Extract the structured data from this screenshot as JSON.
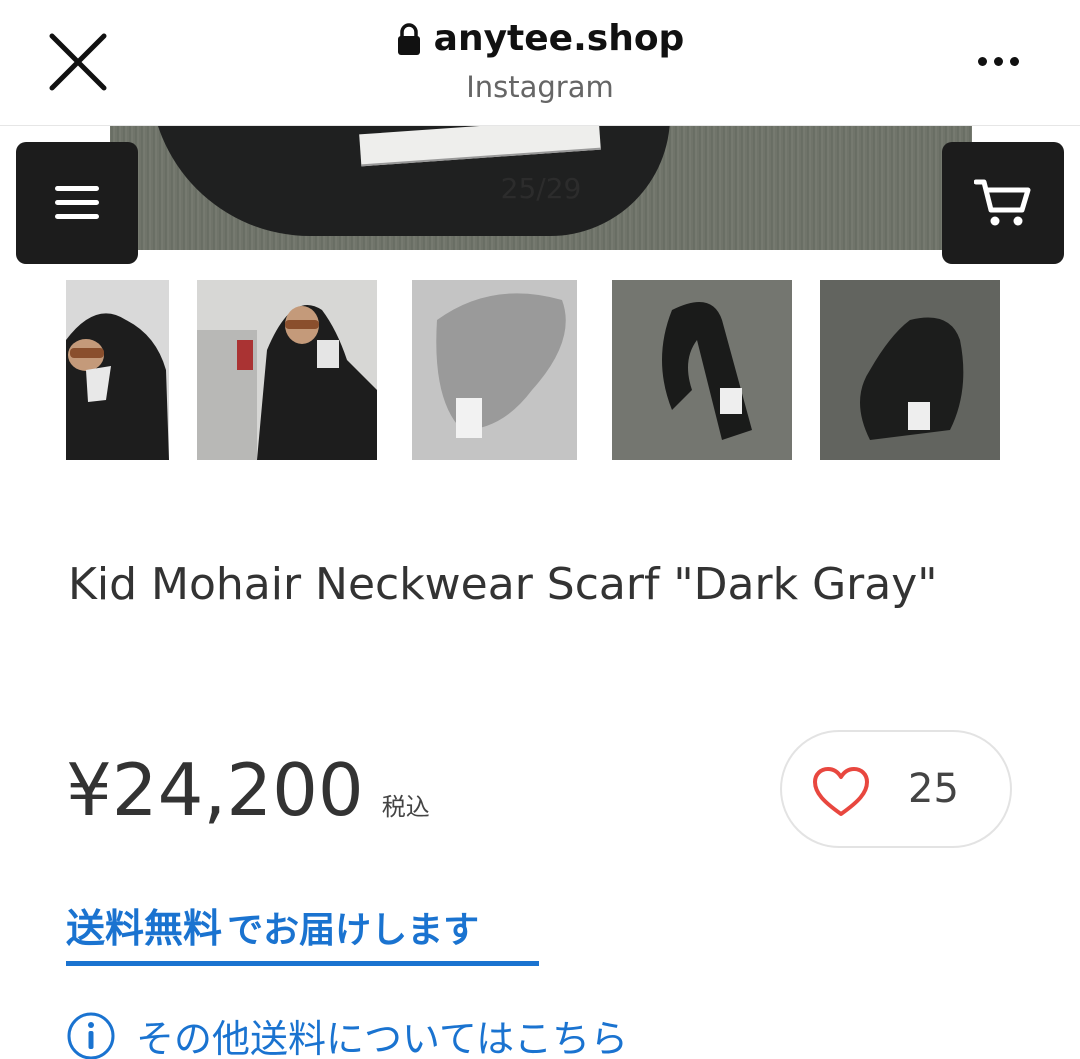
{
  "browser": {
    "domain": "anytee.shop",
    "subtitle": "Instagram"
  },
  "gallery": {
    "counter": "25/29",
    "thumbnails": [
      "thumbnail-1",
      "thumbnail-2",
      "thumbnail-3",
      "thumbnail-4",
      "thumbnail-5"
    ]
  },
  "product": {
    "title": "Kid Mohair Neckwear Scarf \"Dark Gray\"",
    "price": "¥24,200",
    "tax_label": "税込",
    "like_count": "25"
  },
  "shipping": {
    "free_label": "送料無料",
    "free_suffix": "でお届けします",
    "other_link": "その他送料についてはこちら"
  },
  "colors": {
    "accent": "#1a73d0",
    "heart": "#e8473f",
    "dark_button": "#1c1c1c"
  },
  "icons": [
    "close-icon",
    "lock-icon",
    "more-icon",
    "menu-icon",
    "cart-icon",
    "heart-icon",
    "info-icon"
  ]
}
